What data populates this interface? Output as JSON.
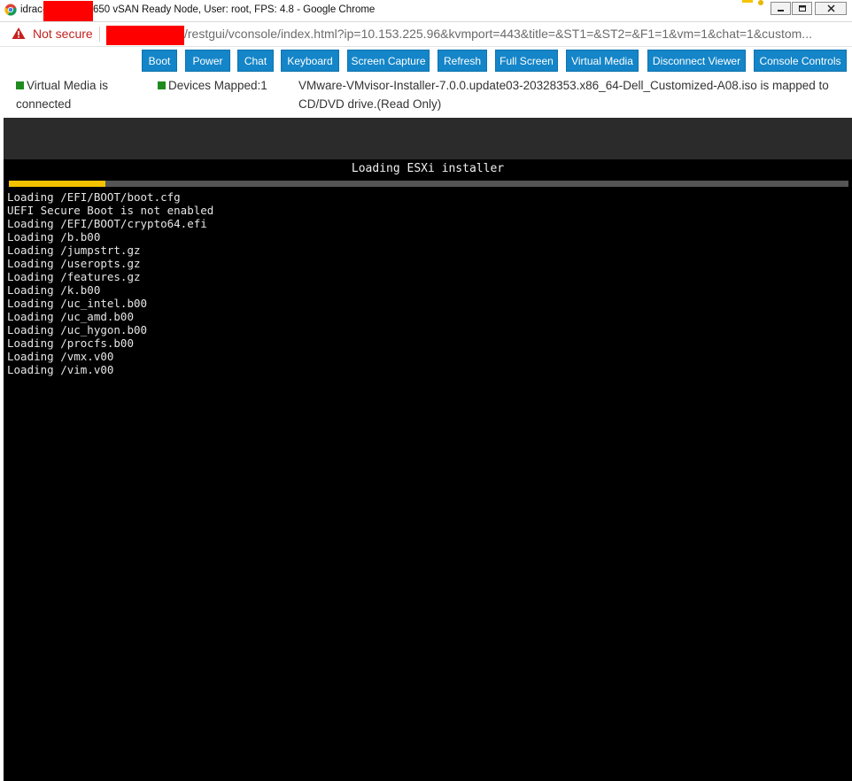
{
  "window": {
    "title_prefix": "idrac-",
    "title_suffix": "650 vSAN Ready Node, User: root, FPS: 4.8 - Google Chrome"
  },
  "address": {
    "security_label": "Not secure",
    "url": "/restgui/vconsole/index.html?ip=10.153.225.96&kvmport=443&title=&ST1=&ST2=&F1=1&vm=1&chat=1&custom..."
  },
  "toolbar": {
    "buttons": [
      {
        "label": "Boot"
      },
      {
        "label": "Power"
      },
      {
        "label": "Chat"
      },
      {
        "label": "Keyboard"
      },
      {
        "label": "Screen Capture"
      },
      {
        "label": "Refresh"
      },
      {
        "label": "Full Screen"
      },
      {
        "label": "Virtual Media"
      },
      {
        "label": "Disconnect Viewer"
      },
      {
        "label": "Console Controls"
      }
    ]
  },
  "status": {
    "virtual_media": "Virtual Media is connected",
    "devices_mapped": "Devices Mapped:1",
    "mapped_info": "VMware-VMvisor-Installer-7.0.0.update03-20328353.x86_64-Dell_Customized-A08.iso is mapped to CD/DVD drive.(Read Only)",
    "indicator_color": "#1f8b1f"
  },
  "console": {
    "heading": "Loading ESXi installer",
    "progress": 0.115,
    "progress_color": "#f2c200",
    "log": [
      "Loading /EFI/BOOT/boot.cfg",
      "UEFI Secure Boot is not enabled",
      "Loading /EFI/BOOT/crypto64.efi",
      "Loading /b.b00",
      "Loading /jumpstrt.gz",
      "Loading /useropts.gz",
      "Loading /features.gz",
      "Loading /k.b00",
      "Loading /uc_intel.b00",
      "Loading /uc_amd.b00",
      "Loading /uc_hygon.b00",
      "Loading /procfs.b00",
      "Loading /vmx.v00",
      "Loading /vim.v00"
    ]
  }
}
